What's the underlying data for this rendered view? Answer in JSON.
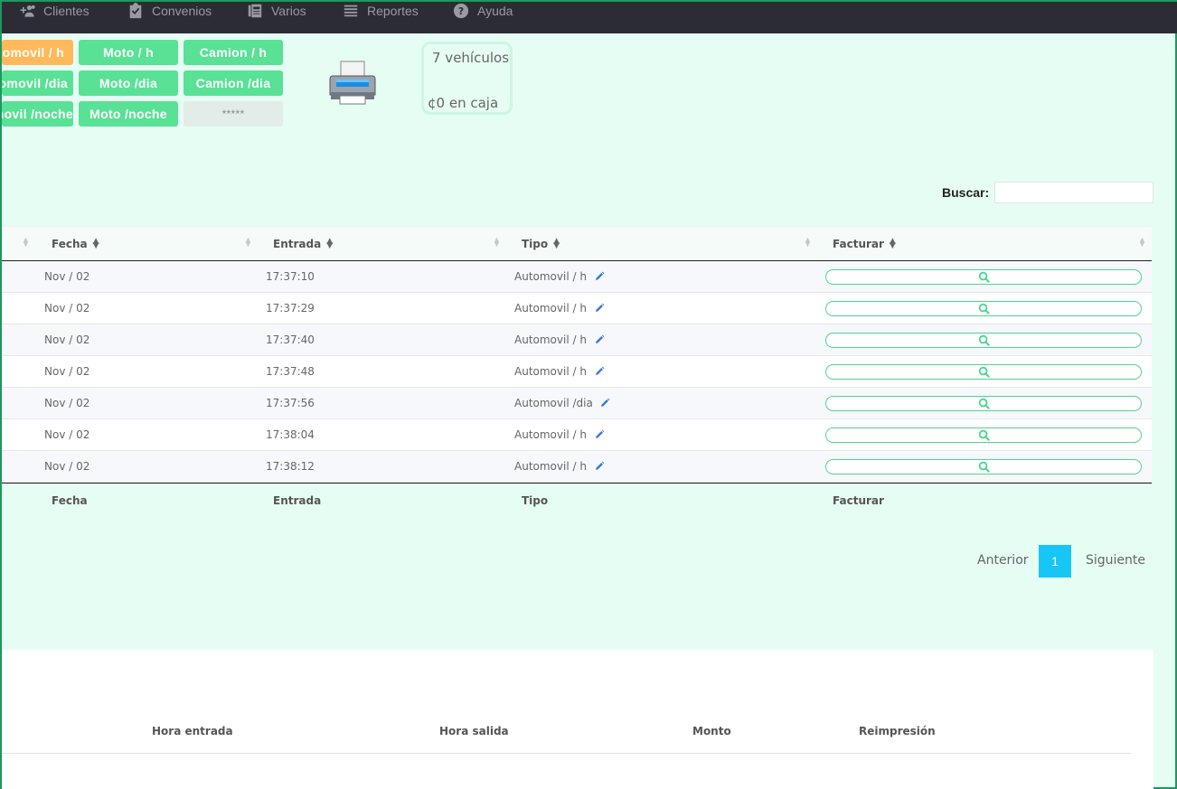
{
  "nav": {
    "items": [
      {
        "label": "Clientes",
        "icon": "add-users-icon"
      },
      {
        "label": "Convenios",
        "icon": "clipboard-check-icon"
      },
      {
        "label": "Varios",
        "icon": "newspaper-icon"
      },
      {
        "label": "Reportes",
        "icon": "list-icon"
      },
      {
        "label": "Ayuda",
        "icon": "help-circle-icon"
      }
    ]
  },
  "rates": {
    "auto_h": "Automovil / h",
    "moto_h": "Moto / h",
    "camion_h": "Camion / h",
    "auto_dia": "Automovil /dia",
    "moto_dia": "Moto /dia",
    "camion_dia": "Camion /dia",
    "auto_noche": "Automovil /noche",
    "moto_noche": "Moto /noche",
    "placeholder": "*****"
  },
  "stats": {
    "vehicles": "7 vehículos",
    "cash": "¢0 en caja"
  },
  "search": {
    "label": "Buscar:",
    "value": ""
  },
  "table": {
    "headers": {
      "fecha": "Fecha",
      "entrada": "Entrada",
      "tipo": "Tipo",
      "facturar": "Facturar"
    },
    "rows": [
      {
        "fecha": "Nov / 02",
        "entrada": "17:37:10",
        "tipo": "Automovil / h"
      },
      {
        "fecha": "Nov / 02",
        "entrada": "17:37:29",
        "tipo": "Automovil / h"
      },
      {
        "fecha": "Nov / 02",
        "entrada": "17:37:40",
        "tipo": "Automovil / h"
      },
      {
        "fecha": "Nov / 02",
        "entrada": "17:37:48",
        "tipo": "Automovil / h"
      },
      {
        "fecha": "Nov / 02",
        "entrada": "17:37:56",
        "tipo": "Automovil /dia"
      },
      {
        "fecha": "Nov / 02",
        "entrada": "17:38:04",
        "tipo": "Automovil / h"
      },
      {
        "fecha": "Nov / 02",
        "entrada": "17:38:12",
        "tipo": "Automovil / h"
      }
    ]
  },
  "pagination": {
    "prev": "Anterior",
    "page": "1",
    "next": "Siguiente"
  },
  "bottom_table": {
    "headers": {
      "hora_entrada": "Hora entrada",
      "hora_salida": "Hora salida",
      "monto": "Monto",
      "reimpresion": "Reimpresión"
    }
  },
  "colors": {
    "accent": "#59e196",
    "active": "#ffb95a",
    "page_bg": "#e6fdf4",
    "pager": "#17c6f5"
  }
}
